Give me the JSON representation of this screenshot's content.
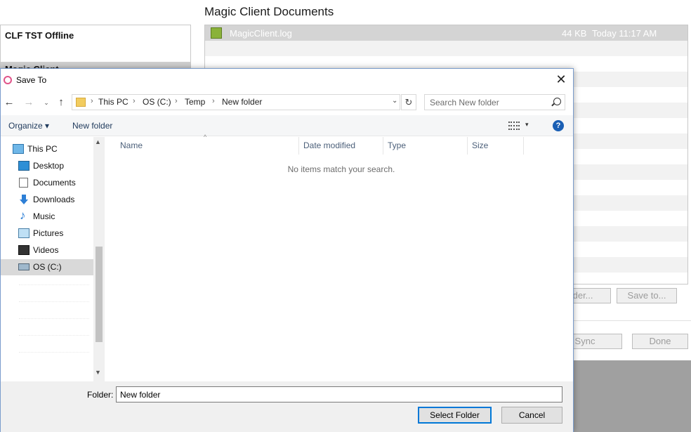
{
  "background_app": {
    "title": "Magic Client Documents",
    "left_panel": {
      "items": [
        "CLF TST Offline",
        "Magic Client"
      ]
    },
    "file_list": [
      {
        "name": "MagicClient.log",
        "size": "44 KB",
        "date": "Today 11:17 AM"
      }
    ],
    "buttons": {
      "folder": "older...",
      "save_to": "Save to...",
      "sync": "Sync",
      "done": "Done"
    }
  },
  "dialog": {
    "title": "Save To",
    "close_glyph": "✕",
    "nav": {
      "back_glyph": "←",
      "forward_glyph": "→",
      "recent_glyph": "⌄",
      "up_glyph": "↑",
      "breadcrumbs": [
        "This PC",
        "OS (C:)",
        "Temp",
        "New folder"
      ],
      "crumb_separator": "›",
      "dropdown_glyph": "⌄",
      "refresh_glyph": "↻",
      "search_placeholder": "Search New folder"
    },
    "toolbar": {
      "organize": "Organize ▾",
      "new_folder": "New folder",
      "view_dropdown": "▾",
      "help_glyph": "?"
    },
    "nav_pane": {
      "items": [
        {
          "label": "This PC",
          "icon": "computer-icon"
        },
        {
          "label": "Desktop",
          "icon": "desktop-icon"
        },
        {
          "label": "Documents",
          "icon": "documents-icon"
        },
        {
          "label": "Downloads",
          "icon": "downloads-icon"
        },
        {
          "label": "Music",
          "icon": "music-icon"
        },
        {
          "label": "Pictures",
          "icon": "pictures-icon"
        },
        {
          "label": "Videos",
          "icon": "videos-icon"
        },
        {
          "label": "OS (C:)",
          "icon": "drive-icon",
          "selected": true
        }
      ],
      "scroll_up": "▲",
      "scroll_down": "▼"
    },
    "columns": {
      "name": "Name",
      "date_modified": "Date modified",
      "type": "Type",
      "size": "Size",
      "sort_caret": "^"
    },
    "empty_message": "No items match your search.",
    "bottom": {
      "folder_label": "Folder:",
      "folder_value": "New folder",
      "select_button": "Select Folder",
      "cancel_button": "Cancel"
    }
  },
  "colors": {
    "accent": "#0078d7",
    "selected_bg": "#d9d9d9",
    "toolbar_text": "#1e395b"
  }
}
